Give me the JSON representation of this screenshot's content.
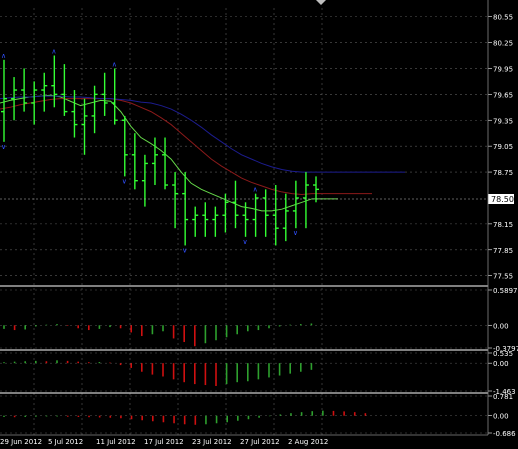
{
  "window": {
    "title": ""
  },
  "colors": {
    "background": "#000000",
    "grid": "#5a5a5a",
    "price_bars": "#33ff33",
    "ma_fast": "#66d94a",
    "ma_mid": "#8b1a1a",
    "ma_slow": "#1c1c8f",
    "hist_up": "#2ea02e",
    "hist_down": "#d01010",
    "fractal": "#3050ff",
    "axis_text": "#ffffff",
    "price_marker_bg": "#ffffff",
    "price_marker_text": "#000000"
  },
  "chart_data": [
    {
      "type": "ohlc",
      "panel": "main",
      "title": "",
      "y_ticks": [
        "80.55",
        "80.25",
        "79.95",
        "79.65",
        "79.35",
        "79.05",
        "78.75",
        "78.15",
        "77.85",
        "77.55"
      ],
      "ylim": [
        77.5,
        80.65
      ],
      "current_price_label": "78.50",
      "current_price": 78.5,
      "x_labels": [
        "29 Jun 2012",
        "5 Jul 2012",
        "11 Jul 2012",
        "17 Jul 2012",
        "23 Jul 2012",
        "27 Jul 2012",
        "2 Aug 2012"
      ],
      "series": [
        {
          "name": "",
          "ohlc": [
            [
              79.45,
              80.05,
              79.1,
              79.6
            ],
            [
              79.6,
              79.85,
              79.35,
              79.7
            ],
            [
              79.7,
              79.95,
              79.45,
              79.55
            ],
            [
              79.55,
              79.8,
              79.3,
              79.7
            ],
            [
              79.7,
              79.9,
              79.45,
              79.75
            ],
            [
              79.75,
              80.1,
              79.5,
              79.65
            ],
            [
              79.65,
              80.0,
              79.4,
              79.45
            ],
            [
              79.45,
              79.7,
              79.15,
              79.3
            ],
            [
              79.3,
              79.6,
              78.95,
              79.4
            ],
            [
              79.4,
              79.75,
              79.2,
              79.65
            ],
            [
              79.65,
              79.9,
              79.4,
              79.55
            ],
            [
              79.55,
              79.95,
              79.3,
              79.35
            ],
            [
              79.35,
              79.4,
              78.7,
              78.95
            ],
            [
              78.95,
              79.2,
              78.55,
              78.65
            ],
            [
              78.65,
              78.95,
              78.35,
              78.85
            ],
            [
              78.85,
              79.15,
              78.6,
              78.95
            ],
            [
              78.95,
              79.15,
              78.55,
              78.6
            ],
            [
              78.6,
              78.75,
              78.1,
              78.5
            ],
            [
              78.5,
              78.75,
              77.9,
              78.2
            ],
            [
              78.2,
              78.35,
              78.0,
              78.25
            ],
            [
              78.25,
              78.4,
              78.0,
              78.2
            ],
            [
              78.2,
              78.35,
              78.0,
              78.25
            ],
            [
              78.25,
              78.5,
              78.05,
              78.4
            ],
            [
              78.4,
              78.65,
              78.1,
              78.25
            ],
            [
              78.25,
              78.4,
              78.0,
              78.2
            ],
            [
              78.2,
              78.5,
              78.0,
              78.45
            ],
            [
              78.45,
              78.55,
              78.0,
              78.25
            ],
            [
              78.25,
              78.6,
              77.9,
              78.1
            ],
            [
              78.1,
              78.5,
              77.95,
              78.3
            ],
            [
              78.3,
              78.65,
              78.1,
              78.45
            ],
            [
              78.45,
              78.75,
              78.1,
              78.6
            ],
            [
              78.6,
              78.7,
              78.4,
              78.55
            ]
          ]
        }
      ],
      "moving_averages": [
        {
          "name": "",
          "color_key": "ma_fast",
          "values": [
            79.55,
            79.58,
            79.6,
            79.62,
            79.63,
            79.64,
            79.62,
            79.57,
            79.52,
            79.55,
            79.58,
            79.57,
            79.45,
            79.28,
            79.15,
            79.08,
            79.0,
            78.9,
            78.75,
            78.62,
            78.55,
            78.5,
            78.45,
            78.4,
            78.35,
            78.33,
            78.3,
            78.3,
            78.32,
            78.36,
            78.4,
            78.44
          ]
        },
        {
          "name": "",
          "color_key": "ma_mid",
          "values": [
            79.48,
            79.5,
            79.53,
            79.55,
            79.57,
            79.59,
            79.6,
            79.6,
            79.6,
            79.6,
            79.6,
            79.6,
            79.58,
            79.55,
            79.5,
            79.45,
            79.38,
            79.3,
            79.2,
            79.1,
            79.0,
            78.9,
            78.82,
            78.75,
            78.68,
            78.63,
            78.59,
            78.55,
            78.52,
            78.5,
            78.49,
            78.5
          ]
        },
        {
          "name": "",
          "color_key": "ma_slow",
          "values": [
            79.6,
            79.61,
            79.62,
            79.62,
            79.63,
            79.63,
            79.63,
            79.62,
            79.62,
            79.61,
            79.6,
            79.6,
            79.59,
            79.58,
            79.56,
            79.55,
            79.52,
            79.48,
            79.42,
            79.35,
            79.27,
            79.18,
            79.1,
            79.02,
            78.95,
            78.9,
            78.85,
            78.81,
            78.78,
            78.76,
            78.75,
            78.75
          ]
        }
      ],
      "fractals": [
        {
          "index": 0,
          "position": "above"
        },
        {
          "index": 0,
          "position": "below"
        },
        {
          "index": 5,
          "position": "above"
        },
        {
          "index": 11,
          "position": "above"
        },
        {
          "index": 12,
          "position": "below"
        },
        {
          "index": 18,
          "position": "below"
        },
        {
          "index": 24,
          "position": "below"
        },
        {
          "index": 25,
          "position": "above"
        },
        {
          "index": 29,
          "position": "below"
        }
      ]
    },
    {
      "type": "histogram",
      "panel": "indicator_1",
      "y_ticks": [
        "0.5897",
        "0.00",
        "-0.3797"
      ],
      "ylim": [
        -0.3797,
        0.5897
      ],
      "values": [
        -0.06,
        -0.08,
        -0.07,
        -0.02,
        0.01,
        0.02,
        -0.01,
        -0.05,
        -0.08,
        -0.06,
        -0.03,
        -0.05,
        -0.12,
        -0.18,
        -0.15,
        -0.1,
        -0.22,
        -0.28,
        -0.35,
        -0.3,
        -0.25,
        -0.2,
        -0.15,
        -0.1,
        -0.08,
        -0.05,
        -0.02,
        0.01,
        0.02,
        0.03
      ]
    },
    {
      "type": "histogram",
      "panel": "indicator_2",
      "y_ticks": [
        "0.535",
        "0.00",
        "-1.463"
      ],
      "ylim": [
        -1.463,
        0.535
      ],
      "values": [
        0.05,
        0.08,
        0.1,
        0.12,
        0.1,
        0.15,
        0.12,
        0.08,
        0.05,
        0.06,
        0.03,
        -0.1,
        -0.25,
        -0.45,
        -0.6,
        -0.7,
        -0.85,
        -1.0,
        -1.1,
        -1.15,
        -1.2,
        -1.1,
        -1.0,
        -0.95,
        -0.85,
        -0.75,
        -0.65,
        -0.55,
        -0.45,
        -0.35
      ]
    },
    {
      "type": "histogram",
      "panel": "indicator_3",
      "y_ticks": [
        "0.781",
        "0.00",
        "-0.686"
      ],
      "ylim": [
        -0.686,
        0.781
      ],
      "values": [
        -0.05,
        -0.06,
        -0.05,
        -0.04,
        -0.03,
        -0.03,
        -0.04,
        -0.05,
        -0.06,
        -0.07,
        -0.08,
        -0.1,
        -0.14,
        -0.18,
        -0.22,
        -0.26,
        -0.3,
        -0.34,
        -0.36,
        -0.34,
        -0.3,
        -0.26,
        -0.2,
        -0.14,
        -0.08,
        -0.02,
        0.05,
        0.1,
        0.14,
        0.18,
        0.2,
        0.19,
        0.17,
        0.14,
        0.1
      ]
    }
  ]
}
